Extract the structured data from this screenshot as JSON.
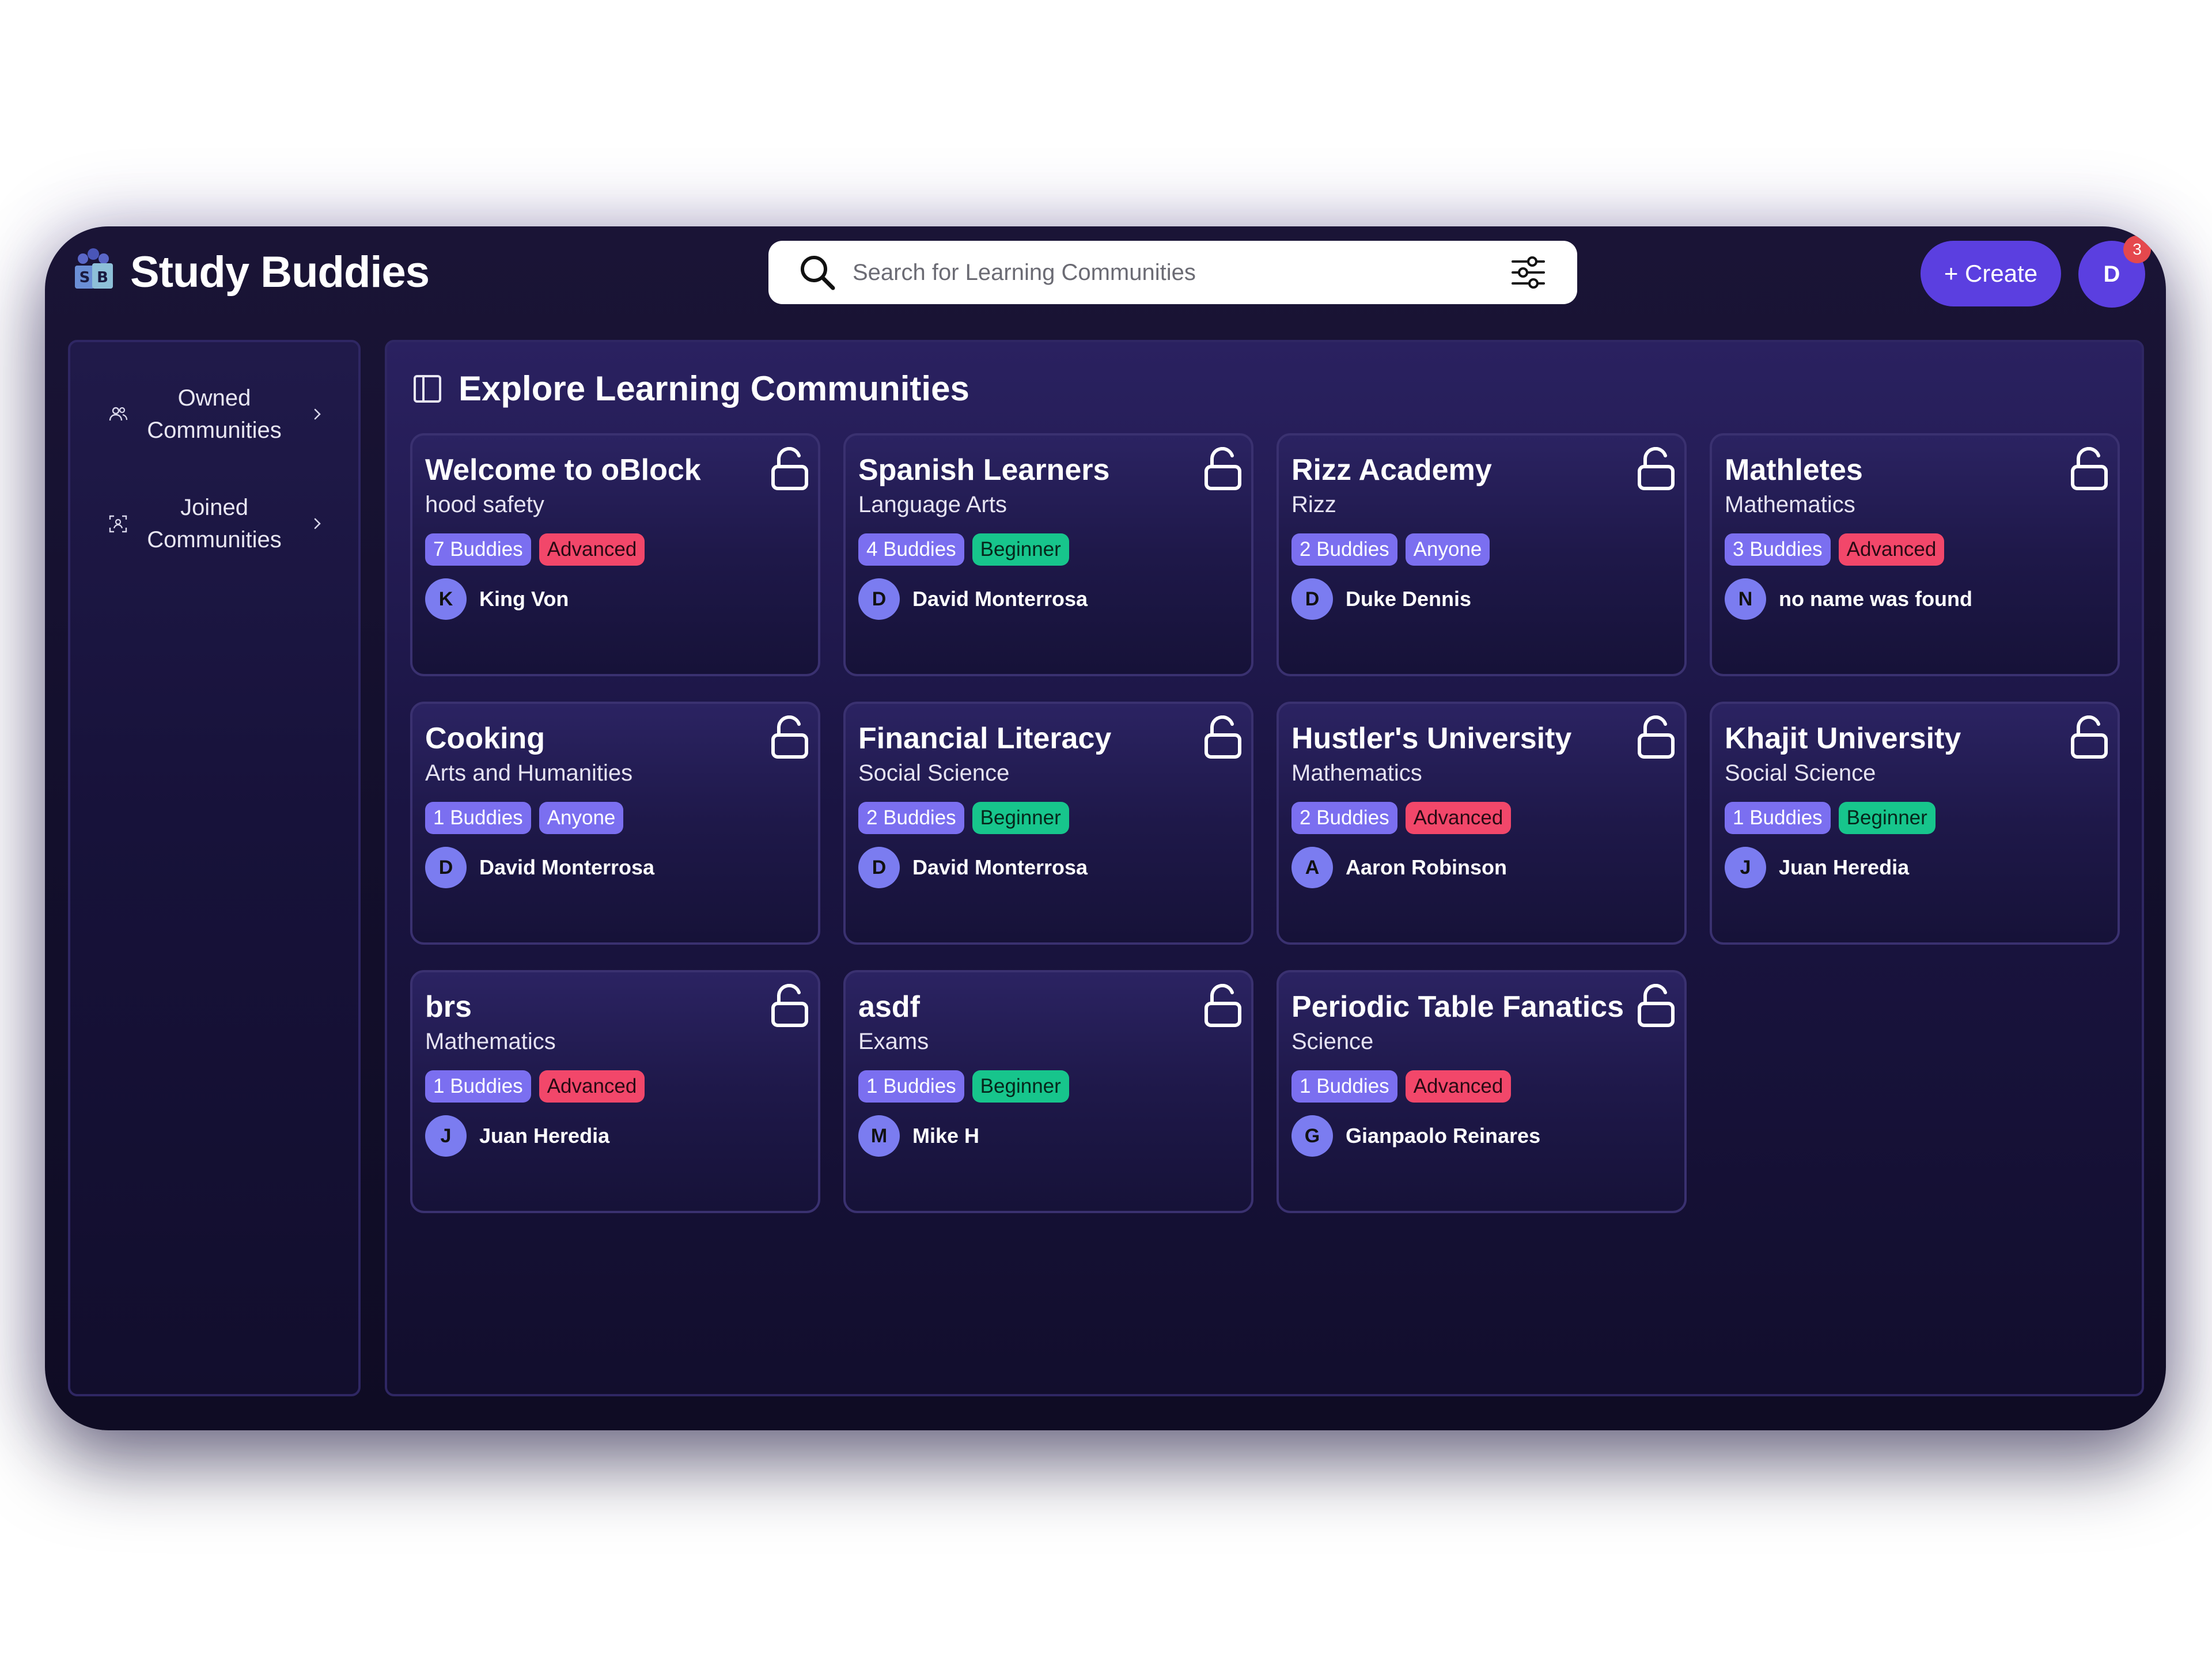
{
  "app": {
    "brand": "Study Buddies",
    "logo_letters": [
      "S",
      "B"
    ]
  },
  "search": {
    "placeholder": "Search for Learning Communities",
    "value": ""
  },
  "header": {
    "create_label": "+ Create",
    "avatar_initial": "D",
    "notification_count": "3"
  },
  "sidebar": {
    "items": [
      {
        "label": "Owned Communities",
        "icon": "users-icon"
      },
      {
        "label": "Joined Communities",
        "icon": "user-scan-icon"
      }
    ]
  },
  "main": {
    "title": "Explore Learning Communities"
  },
  "communities": [
    {
      "title": "Welcome to oBlock",
      "subject": "hood safety",
      "buddies": "7 Buddies",
      "level": "Advanced",
      "owner_initial": "K",
      "owner": "King Von"
    },
    {
      "title": "Spanish Learners",
      "subject": "Language Arts",
      "buddies": "4 Buddies",
      "level": "Beginner",
      "owner_initial": "D",
      "owner": "David Monterrosa"
    },
    {
      "title": "Rizz Academy",
      "subject": "Rizz",
      "buddies": "2 Buddies",
      "level": "Anyone",
      "owner_initial": "D",
      "owner": "Duke Dennis"
    },
    {
      "title": "Mathletes",
      "subject": "Mathematics",
      "buddies": "3 Buddies",
      "level": "Advanced",
      "owner_initial": "N",
      "owner": "no name was found"
    },
    {
      "title": "Cooking",
      "subject": "Arts and Humanities",
      "buddies": "1 Buddies",
      "level": "Anyone",
      "owner_initial": "D",
      "owner": "David Monterrosa"
    },
    {
      "title": "Financial Literacy",
      "subject": "Social Science",
      "buddies": "2 Buddies",
      "level": "Beginner",
      "owner_initial": "D",
      "owner": "David Monterrosa"
    },
    {
      "title": "Hustler's University",
      "subject": "Mathematics",
      "buddies": "2 Buddies",
      "level": "Advanced",
      "owner_initial": "A",
      "owner": "Aaron Robinson"
    },
    {
      "title": "Khajit University",
      "subject": "Social Science",
      "buddies": "1 Buddies",
      "level": "Beginner",
      "owner_initial": "J",
      "owner": "Juan Heredia"
    },
    {
      "title": "brs",
      "subject": "Mathematics",
      "buddies": "1 Buddies",
      "level": "Advanced",
      "owner_initial": "J",
      "owner": "Juan Heredia"
    },
    {
      "title": "asdf",
      "subject": "Exams",
      "buddies": "1 Buddies",
      "level": "Beginner",
      "owner_initial": "M",
      "owner": "Mike H"
    },
    {
      "title": "Periodic Table Fanatics",
      "subject": "Science",
      "buddies": "1 Buddies",
      "level": "Advanced",
      "owner_initial": "G",
      "owner": "Gianpaolo Reinares"
    }
  ],
  "colors": {
    "accent": "#5b3fe0",
    "advanced": "#f2476a",
    "beginner": "#17c58c",
    "anyone": "#7b6ff0",
    "notification": "#e5484d"
  }
}
